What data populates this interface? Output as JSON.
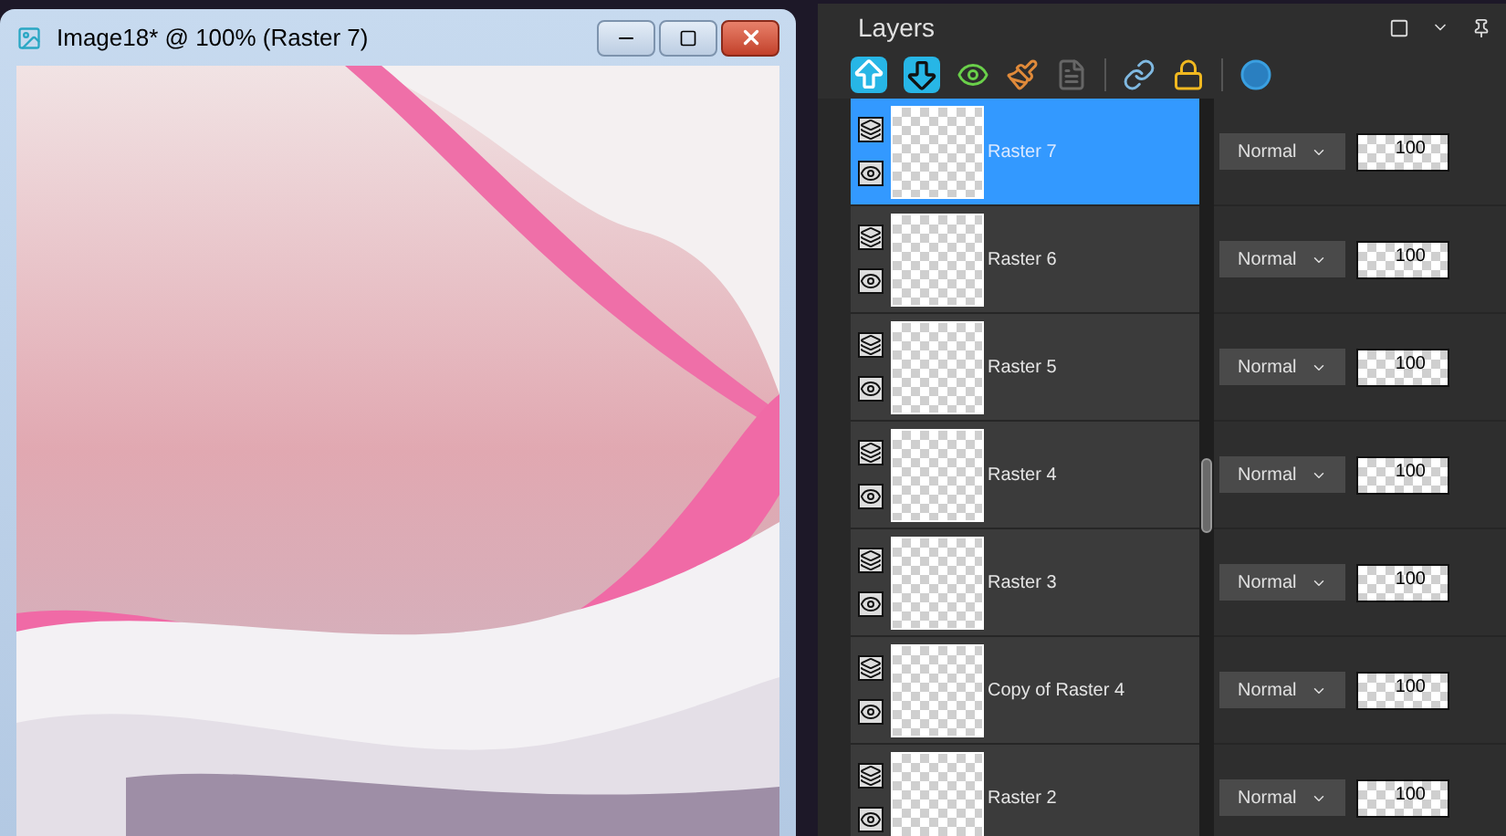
{
  "image_window": {
    "title": "Image18* @ 100% (Raster 7)"
  },
  "layers_panel": {
    "title": "Layers",
    "layers": [
      {
        "name": "Raster 7",
        "selected": true,
        "visible": true,
        "blend_mode": "Normal",
        "opacity": "100"
      },
      {
        "name": "Raster 6",
        "selected": false,
        "visible": true,
        "blend_mode": "Normal",
        "opacity": "100"
      },
      {
        "name": "Raster 5",
        "selected": false,
        "visible": true,
        "blend_mode": "Normal",
        "opacity": "100"
      },
      {
        "name": "Raster 4",
        "selected": false,
        "visible": true,
        "blend_mode": "Normal",
        "opacity": "100"
      },
      {
        "name": "Raster 3",
        "selected": false,
        "visible": true,
        "blend_mode": "Normal",
        "opacity": "100"
      },
      {
        "name": "Copy of Raster 4",
        "selected": false,
        "visible": true,
        "blend_mode": "Normal",
        "opacity": "100"
      },
      {
        "name": "Raster 2",
        "selected": false,
        "visible": true,
        "blend_mode": "Normal",
        "opacity": "100"
      }
    ]
  }
}
